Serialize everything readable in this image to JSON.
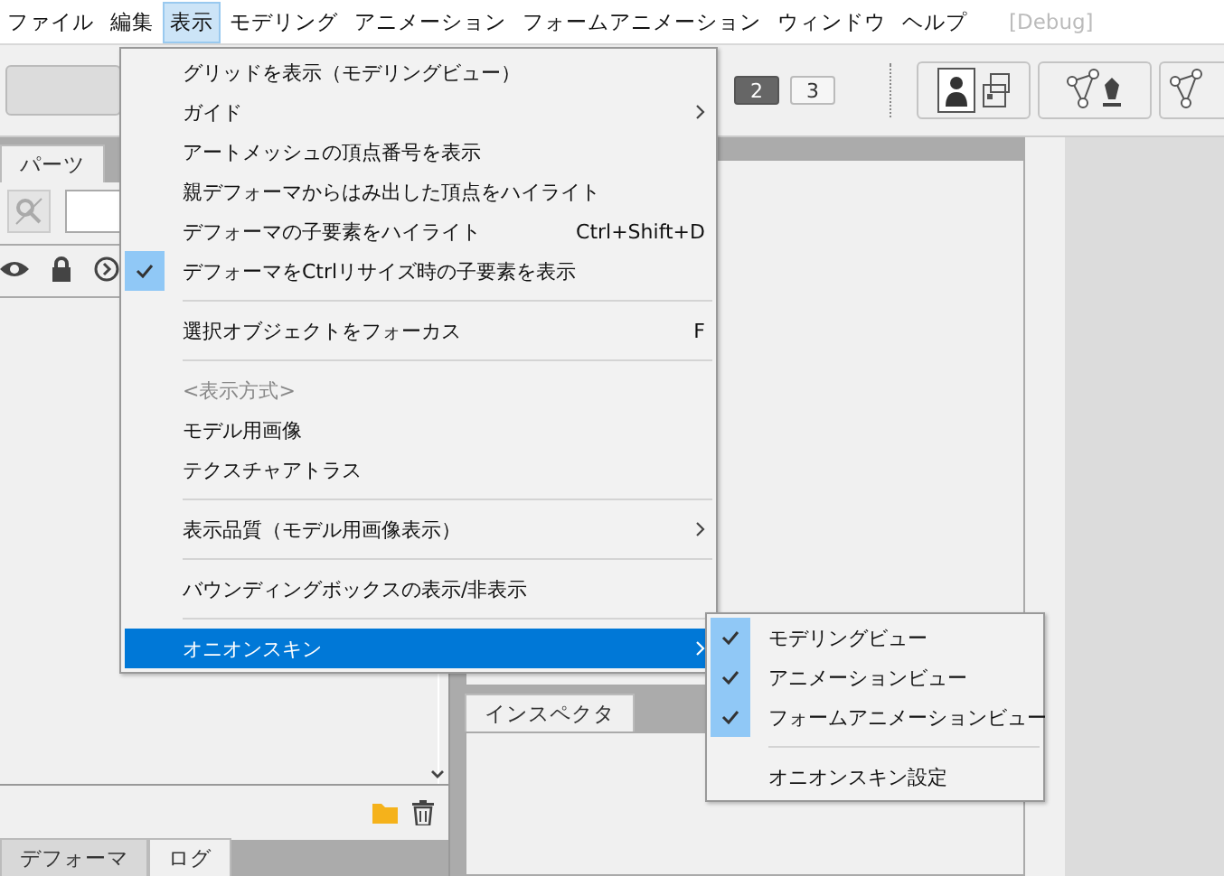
{
  "menubar": [
    {
      "label": "ファイル",
      "selected": false
    },
    {
      "label": "編集",
      "selected": false
    },
    {
      "label": "表示",
      "selected": true
    },
    {
      "label": "モデリング",
      "selected": false
    },
    {
      "label": "アニメーション",
      "selected": false
    },
    {
      "label": "フォームアニメーション",
      "selected": false
    },
    {
      "label": "ウィンドウ",
      "selected": false
    },
    {
      "label": "ヘルプ",
      "selected": false
    },
    {
      "label": "[Debug]",
      "selected": false,
      "disabled": true
    }
  ],
  "toolbar": {
    "pages": [
      {
        "label": "2",
        "selected": true
      },
      {
        "label": "3",
        "selected": false
      }
    ]
  },
  "parts_panel": {
    "tabs": [
      {
        "label": "パーツ",
        "selected": true
      }
    ]
  },
  "bottom_tabs": [
    {
      "label": "デフォーマ",
      "selected": false
    },
    {
      "label": "ログ",
      "selected": true
    }
  ],
  "inspector": {
    "tabs": [
      {
        "label": "インスペクタ",
        "selected": true
      }
    ]
  },
  "view_menu": [
    {
      "kind": "item",
      "label": "グリッドを表示（モデリングビュー）",
      "checked": false,
      "highlighted": false
    },
    {
      "kind": "item",
      "label": "ガイド",
      "checked": false,
      "highlighted": false,
      "submenu": true
    },
    {
      "kind": "item",
      "label": "アートメッシュの頂点番号を表示",
      "checked": false,
      "highlighted": false
    },
    {
      "kind": "item",
      "label": "親デフォーマからはみ出した頂点をハイライト",
      "checked": false,
      "highlighted": false
    },
    {
      "kind": "item",
      "label": "デフォーマの子要素をハイライト",
      "shortcut": "Ctrl+Shift+D",
      "checked": false,
      "highlighted": false
    },
    {
      "kind": "item",
      "label": "デフォーマをCtrlリサイズ時の子要素を表示",
      "checked": true,
      "highlighted": false
    },
    {
      "kind": "separator"
    },
    {
      "kind": "item",
      "label": "選択オブジェクトをフォーカス",
      "shortcut": "F",
      "checked": false,
      "highlighted": false
    },
    {
      "kind": "separator"
    },
    {
      "kind": "header",
      "label": "<表示方式>"
    },
    {
      "kind": "item",
      "label": "モデル用画像",
      "checked": false,
      "highlighted": false
    },
    {
      "kind": "item",
      "label": "テクスチャアトラス",
      "checked": false,
      "highlighted": false
    },
    {
      "kind": "separator"
    },
    {
      "kind": "item",
      "label": "表示品質（モデル用画像表示）",
      "checked": false,
      "highlighted": false,
      "submenu": true
    },
    {
      "kind": "separator"
    },
    {
      "kind": "item",
      "label": "バウンディングボックスの表示/非表示",
      "checked": false,
      "highlighted": false
    },
    {
      "kind": "separator"
    },
    {
      "kind": "item",
      "label": "オニオンスキン",
      "checked": false,
      "highlighted": true,
      "submenu": true
    }
  ],
  "onion_submenu": [
    {
      "kind": "item",
      "label": "モデリングビュー",
      "checked": true,
      "highlighted": false
    },
    {
      "kind": "item",
      "label": "アニメーションビュー",
      "checked": true,
      "highlighted": false
    },
    {
      "kind": "item",
      "label": "フォームアニメーションビュー",
      "checked": true,
      "highlighted": false
    },
    {
      "kind": "separator"
    },
    {
      "kind": "item",
      "label": "オニオンスキン設定",
      "checked": false,
      "highlighted": false
    }
  ]
}
